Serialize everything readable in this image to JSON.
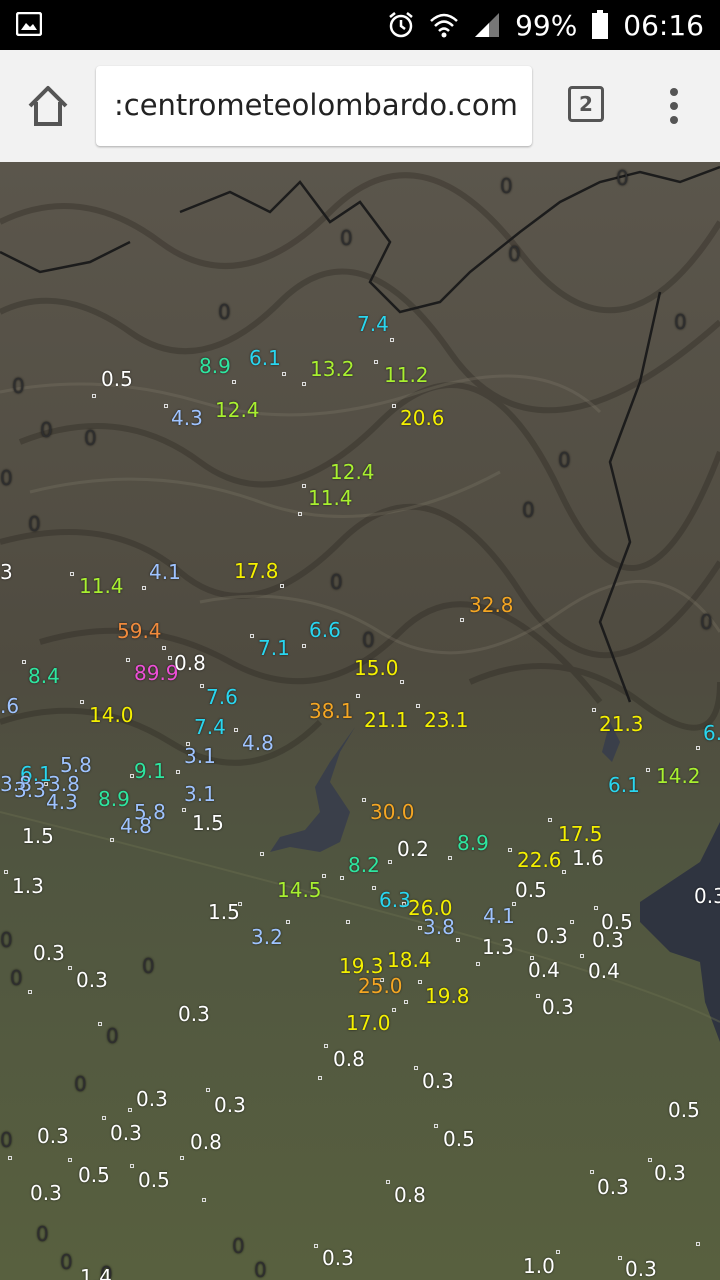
{
  "status_bar": {
    "battery": "99%",
    "time": "06:16",
    "icons": [
      "gallery-icon",
      "alarm-icon",
      "wifi-icon",
      "signal-icon",
      "battery-icon"
    ]
  },
  "browser": {
    "url": ":centrometeolombardo.com",
    "tab_count": "2",
    "icons": [
      "home-icon",
      "overflow-menu-icon"
    ]
  },
  "colors": {
    "white": "#ffffff",
    "light_blue": "#9fc3ff",
    "cyan": "#29d6f0",
    "green": "#2ee6a0",
    "lime": "#a8f030",
    "yellow": "#f5f000",
    "orange": "#f5a623",
    "dark_orange": "#f08a3c",
    "magenta": "#ee4fd8",
    "zero_gray": "#2e2e2e"
  },
  "rain_values": [
    {
      "v": "7.4",
      "c": "cyan"
    },
    {
      "v": "0.5",
      "c": "white"
    },
    {
      "v": "8.9",
      "c": "green"
    },
    {
      "v": "6.1",
      "c": "cyan"
    },
    {
      "v": "13.2",
      "c": "lime"
    },
    {
      "v": "11.2",
      "c": "lime"
    },
    {
      "v": "4.3",
      "c": "light_blue"
    },
    {
      "v": "12.4",
      "c": "lime"
    },
    {
      "v": "20.6",
      "c": "yellow"
    },
    {
      "v": "12.4",
      "c": "lime"
    },
    {
      "v": "11.4",
      "c": "lime"
    },
    {
      "v": "3",
      "c": "white"
    },
    {
      "v": "11.4",
      "c": "lime"
    },
    {
      "v": "4.1",
      "c": "light_blue"
    },
    {
      "v": "17.8",
      "c": "yellow"
    },
    {
      "v": "32.8",
      "c": "orange"
    },
    {
      "v": "59.4",
      "c": "dark_orange"
    },
    {
      "v": "6.6",
      "c": "cyan"
    },
    {
      "v": "7.1",
      "c": "cyan"
    },
    {
      "v": "8.4",
      "c": "green"
    },
    {
      "v": "89.9",
      "c": "magenta"
    },
    {
      "v": "0.8",
      "c": "white"
    },
    {
      "v": "15.0",
      "c": "yellow"
    },
    {
      "v": ".6",
      "c": "light_blue"
    },
    {
      "v": "7.6",
      "c": "cyan"
    },
    {
      "v": "14.0",
      "c": "yellow"
    },
    {
      "v": "38.1",
      "c": "orange"
    },
    {
      "v": "21.1",
      "c": "yellow"
    },
    {
      "v": "23.1",
      "c": "yellow"
    },
    {
      "v": "21.3",
      "c": "yellow"
    },
    {
      "v": "6.",
      "c": "cyan"
    },
    {
      "v": "7.4",
      "c": "cyan"
    },
    {
      "v": "4.8",
      "c": "light_blue"
    },
    {
      "v": "3.1",
      "c": "light_blue"
    },
    {
      "v": "5.8",
      "c": "light_blue"
    },
    {
      "v": "6.1",
      "c": "cyan"
    },
    {
      "v": "9.1",
      "c": "green"
    },
    {
      "v": "14.2",
      "c": "lime"
    },
    {
      "v": "3.8",
      "c": "light_blue"
    },
    {
      "v": "3.3",
      "c": "light_blue"
    },
    {
      "v": "3.8",
      "c": "light_blue"
    },
    {
      "v": "6.1",
      "c": "cyan"
    },
    {
      "v": "4.3",
      "c": "light_blue"
    },
    {
      "v": "8.9",
      "c": "green"
    },
    {
      "v": "3.1",
      "c": "light_blue"
    },
    {
      "v": "5.8",
      "c": "light_blue"
    },
    {
      "v": "30.0",
      "c": "orange"
    },
    {
      "v": "4.8",
      "c": "light_blue"
    },
    {
      "v": "1.5",
      "c": "white"
    },
    {
      "v": "1.5",
      "c": "white"
    },
    {
      "v": "17.5",
      "c": "yellow"
    },
    {
      "v": "8.9",
      "c": "green"
    },
    {
      "v": "0.2",
      "c": "white"
    },
    {
      "v": "22.6",
      "c": "yellow"
    },
    {
      "v": "1.6",
      "c": "white"
    },
    {
      "v": "8.2",
      "c": "green"
    },
    {
      "v": "1.3",
      "c": "white"
    },
    {
      "v": "14.5",
      "c": "lime"
    },
    {
      "v": "0.5",
      "c": "white"
    },
    {
      "v": "0.3",
      "c": "white"
    },
    {
      "v": "6.3",
      "c": "cyan"
    },
    {
      "v": "26.0",
      "c": "yellow"
    },
    {
      "v": "1.5",
      "c": "white"
    },
    {
      "v": "4.1",
      "c": "light_blue"
    },
    {
      "v": "0.5",
      "c": "white"
    },
    {
      "v": "3.8",
      "c": "light_blue"
    },
    {
      "v": "3.2",
      "c": "light_blue"
    },
    {
      "v": "0.3",
      "c": "white"
    },
    {
      "v": "0.3",
      "c": "white"
    },
    {
      "v": "1.3",
      "c": "white"
    },
    {
      "v": "0.3",
      "c": "white"
    },
    {
      "v": "19.3",
      "c": "yellow"
    },
    {
      "v": "18.4",
      "c": "yellow"
    },
    {
      "v": "0.4",
      "c": "white"
    },
    {
      "v": "0.4",
      "c": "white"
    },
    {
      "v": "0.3",
      "c": "white"
    },
    {
      "v": "25.0",
      "c": "orange"
    },
    {
      "v": "19.8",
      "c": "yellow"
    },
    {
      "v": "0.3",
      "c": "white"
    },
    {
      "v": "0.3",
      "c": "white"
    },
    {
      "v": "17.0",
      "c": "yellow"
    },
    {
      "v": "0.8",
      "c": "white"
    },
    {
      "v": "0.3",
      "c": "white"
    },
    {
      "v": "0.3",
      "c": "white"
    },
    {
      "v": "0.3",
      "c": "white"
    },
    {
      "v": "0.5",
      "c": "white"
    },
    {
      "v": "0.3",
      "c": "white"
    },
    {
      "v": "0.3",
      "c": "white"
    },
    {
      "v": "0.8",
      "c": "white"
    },
    {
      "v": "0.5",
      "c": "white"
    },
    {
      "v": "0.5",
      "c": "white"
    },
    {
      "v": "0.5",
      "c": "white"
    },
    {
      "v": "0.3",
      "c": "white"
    },
    {
      "v": "0.3",
      "c": "white"
    },
    {
      "v": "0.3",
      "c": "white"
    },
    {
      "v": "0.8",
      "c": "white"
    },
    {
      "v": "0.3",
      "c": "white"
    },
    {
      "v": "1.0",
      "c": "white"
    },
    {
      "v": "0.3",
      "c": "white"
    },
    {
      "v": "1.4",
      "c": "white"
    }
  ],
  "zero_values": [
    "0",
    "0",
    "0",
    "0",
    "0",
    "0",
    "0",
    "0",
    "0",
    "0",
    "0",
    "0",
    "0",
    "0",
    "0",
    "0",
    "0",
    "0",
    "0",
    "0",
    "0",
    "0",
    "0",
    "0",
    "0",
    "0",
    "0"
  ]
}
